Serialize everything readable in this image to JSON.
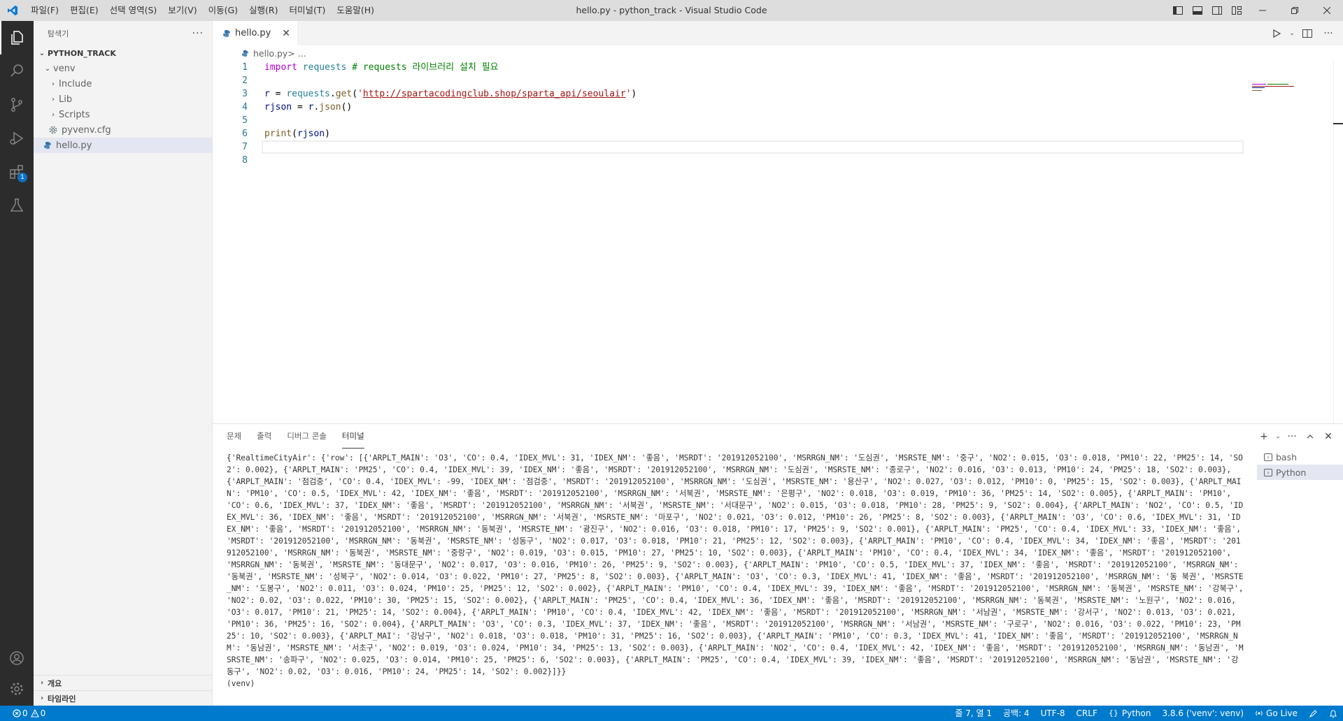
{
  "window": {
    "title": "hello.py - python_track - Visual Studio Code",
    "menu": [
      "파일(F)",
      "편집(E)",
      "선택 영역(S)",
      "보기(V)",
      "이동(G)",
      "실행(R)",
      "터미널(T)",
      "도움말(H)"
    ]
  },
  "activity": {
    "extensions_badge": "1"
  },
  "sidebar": {
    "title": "탐색기",
    "more": "···",
    "root": "PYTHON_TRACK",
    "tree": [
      {
        "label": "venv"
      },
      {
        "label": "Include"
      },
      {
        "label": "Lib"
      },
      {
        "label": "Scripts"
      },
      {
        "label": "pyvenv.cfg"
      },
      {
        "label": "hello.py"
      }
    ],
    "sections": [
      "개요",
      "타임라인"
    ]
  },
  "editor": {
    "tab_label": "hello.py",
    "breadcrumb": {
      "file": "hello.py",
      "sep": " > ..."
    },
    "code": [
      {
        "n": "1",
        "parts": [
          {
            "t": "import",
            "c": "kw"
          },
          {
            "t": " ",
            "c": ""
          },
          {
            "t": "requests",
            "c": "mod"
          },
          {
            "t": " # requests 라이브러리 설치 필요",
            "c": "cm"
          }
        ]
      },
      {
        "n": "2",
        "parts": []
      },
      {
        "n": "3",
        "parts": [
          {
            "t": "r",
            "c": "var"
          },
          {
            "t": " = ",
            "c": ""
          },
          {
            "t": "requests",
            "c": "mod"
          },
          {
            "t": ".",
            "c": ""
          },
          {
            "t": "get",
            "c": "fn"
          },
          {
            "t": "(",
            "c": ""
          },
          {
            "t": "'",
            "c": "str"
          },
          {
            "t": "http://spartacodingclub.shop/sparta_api/seoulair",
            "c": "str url"
          },
          {
            "t": "'",
            "c": "str"
          },
          {
            "t": ")",
            "c": ""
          }
        ]
      },
      {
        "n": "4",
        "parts": [
          {
            "t": "rjson",
            "c": "var"
          },
          {
            "t": " = ",
            "c": ""
          },
          {
            "t": "r",
            "c": "var"
          },
          {
            "t": ".",
            "c": ""
          },
          {
            "t": "json",
            "c": "fn"
          },
          {
            "t": "()",
            "c": ""
          }
        ]
      },
      {
        "n": "5",
        "parts": []
      },
      {
        "n": "6",
        "parts": [
          {
            "t": "print",
            "c": "fn"
          },
          {
            "t": "(",
            "c": ""
          },
          {
            "t": "rjson",
            "c": "var"
          },
          {
            "t": ")",
            "c": ""
          }
        ]
      },
      {
        "n": "7",
        "parts": []
      },
      {
        "n": "8",
        "parts": []
      }
    ]
  },
  "panel": {
    "tabs": [
      "문제",
      "출력",
      "디버그 콘솔",
      "터미널"
    ],
    "active_tab": "터미널",
    "terminal_output": "{'RealtimeCityAir': {'row': [{'ARPLT_MAIN': 'O3', 'CO': 0.4, 'IDEX_MVL': 31, 'IDEX_NM': '좋음', 'MSRDT': '201912052100', 'MSRRGN_NM': '도심권', 'MSRSTE_NM': '중구', 'NO2': 0.015, 'O3': 0.018, 'PM10': 22, 'PM25': 14, 'SO2': 0.002}, {'ARPLT_MAIN': 'PM25', 'CO': 0.4, 'IDEX_MVL': 39, 'IDEX_NM': '좋음', 'MSRDT': '201912052100', 'MSRRGN_NM': '도심권', 'MSRSTE_NM': '종로구', 'NO2': 0.016, 'O3': 0.013, 'PM10': 24, 'PM25': 18, 'SO2': 0.003}, {'ARPLT_MAIN': '점검중', 'CO': 0.4, 'IDEX_MVL': -99, 'IDEX_NM': '점검중', 'MSRDT': '201912052100', 'MSRRGN_NM': '도심권', 'MSRSTE_NM': '용산구', 'NO2': 0.027, 'O3': 0.012, 'PM10': 0, 'PM25': 15, 'SO2': 0.003}, {'ARPLT_MAIN': 'PM10', 'CO': 0.5, 'IDEX_MVL': 42, 'IDEX_NM': '좋음', 'MSRDT': '201912052100', 'MSRRGN_NM': '서북권', 'MSRSTE_NM': '은평구', 'NO2': 0.018, 'O3': 0.019, 'PM10': 36, 'PM25': 14, 'SO2': 0.005}, {'ARPLT_MAIN': 'PM10', 'CO': 0.6, 'IDEX_MVL': 37, 'IDEX_NM': '좋음', 'MSRDT': '201912052100', 'MSRRGN_NM': '서북권', 'MSRSTE_NM': '서대문구', 'NO2': 0.015, 'O3': 0.018, 'PM10': 28, 'PM25': 9, 'SO2': 0.004}, {'ARPLT_MAIN': 'NO2', 'CO': 0.5, 'IDEX_MVL': 36, 'IDEX_NM': '좋음', 'MSRDT': '201912052100', 'MSRRGN_NM': '서북권', 'MSRSTE_NM': '마포구', 'NO2': 0.021, 'O3': 0.012, 'PM10': 26, 'PM25': 8, 'SO2': 0.003}, {'ARPLT_MAIN': 'O3', 'CO': 0.6, 'IDEX_MVL': 31, 'IDEX_NM': '좋음', 'MSRDT': '201912052100', 'MSRRGN_NM': '동북권', 'MSRSTE_NM': '광진구', 'NO2': 0.016, 'O3': 0.018, 'PM10': 17, 'PM25': 9, 'SO2': 0.001}, {'ARPLT_MAIN': 'PM25', 'CO': 0.4, 'IDEX_MVL': 33, 'IDEX_NM': '좋음', 'MSRDT': '201912052100', 'MSRRGN_NM': '동북권', 'MSRSTE_NM': '성동구', 'NO2': 0.017, 'O3': 0.018, 'PM10': 21, 'PM25': 12, 'SO2': 0.003}, {'ARPLT_MAIN': 'PM10', 'CO': 0.4, 'IDEX_MVL': 34, 'IDEX_NM': '좋음', 'MSRDT': '201912052100', 'MSRRGN_NM': '동북권', 'MSRSTE_NM': '중랑구', 'NO2': 0.019, 'O3': 0.015, 'PM10': 27, 'PM25': 10, 'SO2': 0.003}, {'ARPLT_MAIN': 'PM10', 'CO': 0.4, 'IDEX_MVL': 34, 'IDEX_NM': '좋음', 'MSRDT': '201912052100', 'MSRRGN_NM': '동북권', 'MSRSTE_NM': '동대문구', 'NO2': 0.017, 'O3': 0.016, 'PM10': 26, 'PM25': 9, 'SO2': 0.003}, {'ARPLT_MAIN': 'PM10', 'CO': 0.5, 'IDEX_MVL': 37, 'IDEX_NM': '좋음', 'MSRDT': '201912052100', 'MSRRGN_NM': '동북권', 'MSRSTE_NM': '성북구', 'NO2': 0.014, 'O3': 0.022, 'PM10': 27, 'PM25': 8, 'SO2': 0.003}, {'ARPLT_MAIN': 'O3', 'CO': 0.3, 'IDEX_MVL': 41, 'IDEX_NM': '좋음', 'MSRDT': '201912052100', 'MSRRGN_NM': '동 북권', 'MSRSTE_NM': '도봉구', 'NO2': 0.011, 'O3': 0.024, 'PM10': 25, 'PM25': 12, 'SO2': 0.002}, {'ARPLT_MAIN': 'PM10', 'CO': 0.4, 'IDEX_MVL': 39, 'IDEX_NM': '좋음', 'MSRDT': '201912052100', 'MSRRGN_NM': '동북권', 'MSRSTE_NM': '강북구', 'NO2': 0.02, 'O3': 0.022, 'PM10': 30, 'PM25': 15, 'SO2': 0.002}, {'ARPLT_MAIN': 'PM25', 'CO': 0.4, 'IDEX_MVL': 36, 'IDEX_NM': '좋음', 'MSRDT': '201912052100', 'MSRRGN_NM': '동북권', 'MSRSTE_NM': '노원구', 'NO2': 0.016, 'O3': 0.017, 'PM10': 21, 'PM25': 14, 'SO2': 0.004}, {'ARPLT_MAIN': 'PM10', 'CO': 0.4, 'IDEX_MVL': 42, 'IDEX_NM': '좋음', 'MSRDT': '201912052100', 'MSRRGN_NM': '서남권', 'MSRSTE_NM': '강서구', 'NO2': 0.013, 'O3': 0.021, 'PM10': 36, 'PM25': 16, 'SO2': 0.004}, {'ARPLT_MAIN': 'O3', 'CO': 0.3, 'IDEX_MVL': 37, 'IDEX_NM': '좋음', 'MSRDT': '201912052100', 'MSRRGN_NM': '서남권', 'MSRSTE_NM': '구로구', 'NO2': 0.016, 'O3': 0.022, 'PM10': 23, 'PM25': 10, 'SO2': 0.003}, {'ARPLT_MAI': '강남구', 'NO2': 0.018, 'O3': 0.018, 'PM10': 31, 'PM25': 16, 'SO2': 0.003}, {'ARPLT_MAIN': 'PM10', 'CO': 0.3, 'IDEX_MVL': 41, 'IDEX_NM': '좋음', 'MSRDT': '201912052100', 'MSRRGN_NM': '동남권', 'MSRSTE_NM': '서초구', 'NO2': 0.019, 'O3': 0.024, 'PM10': 34, 'PM25': 13, 'SO2': 0.003}, {'ARPLT_MAIN': 'NO2', 'CO': 0.4, 'IDEX_MVL': 42, 'IDEX_NM': '좋음', 'MSRDT': '201912052100', 'MSRRGN_NM': '동남권', 'MSRSTE_NM': '송파구', 'NO2': 0.025, 'O3': 0.014, 'PM10': 25, 'PM25': 6, 'SO2': 0.003}, {'ARPLT_MAIN': 'PM25', 'CO': 0.4, 'IDEX_MVL': 39, 'IDEX_NM': '좋음', 'MSRDT': '201912052100', 'MSRRGN_NM': '동남권', 'MSRSTE_NM': '강동구', 'NO2': 0.02, 'O3': 0.016, 'PM10': 24, 'PM25': 14, 'SO2': 0.002}]}}\n(venv)",
    "terminals": [
      "bash",
      "Python"
    ]
  },
  "statusbar": {
    "problems_errors": "0",
    "problems_warnings": "0",
    "position": "줄 7, 열 1",
    "spaces": "공백: 4",
    "encoding": "UTF-8",
    "eol": "CRLF",
    "language": "Python",
    "interpreter": "3.8.6 ('venv': venv)",
    "golive": "Go Live"
  },
  "colors": {
    "accent": "#007acc",
    "activity_bar": "#2c2c2c",
    "sidebar": "#f3f3f3",
    "titlebar": "#dddddd"
  }
}
